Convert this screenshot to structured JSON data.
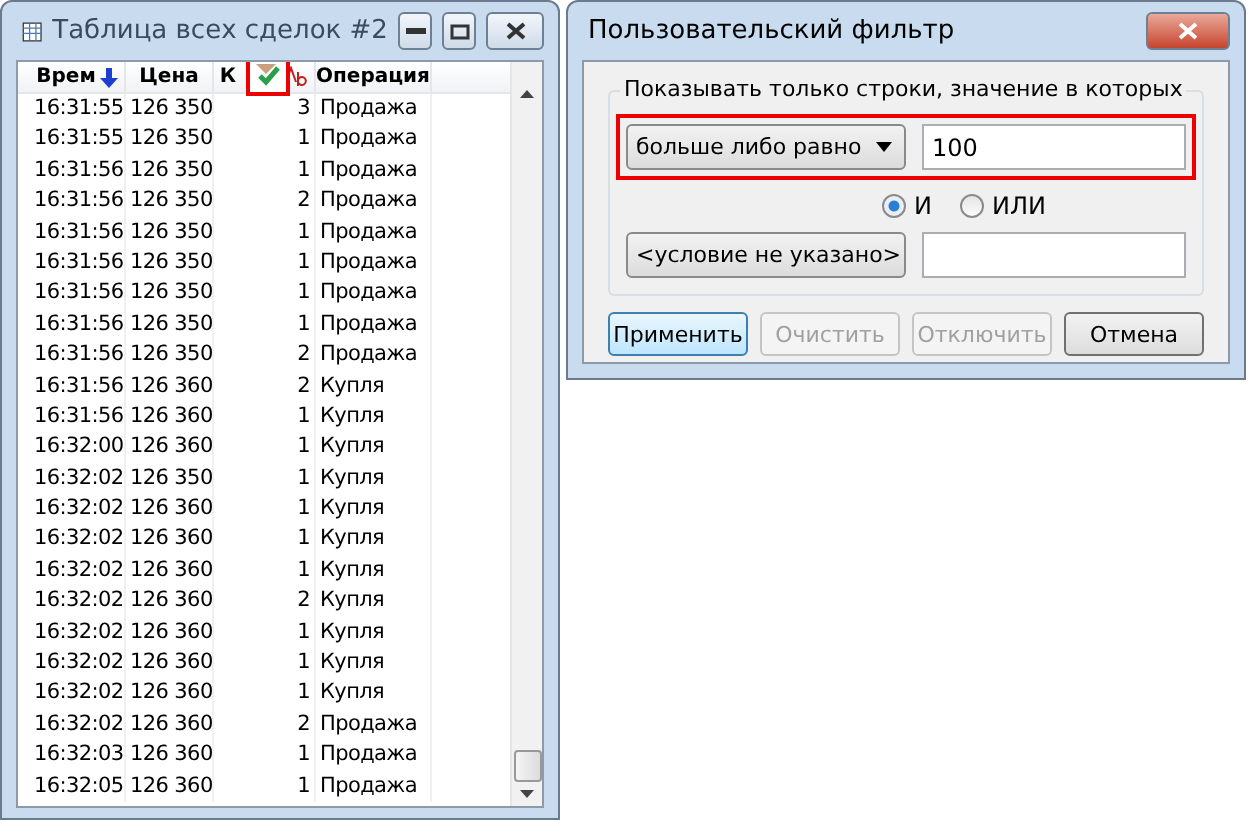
{
  "trades_window": {
    "title": "Таблица всех сделок #2",
    "columns": [
      "Врем",
      "Цена",
      "К",
      "Операция"
    ],
    "rows": [
      [
        "16:31:55",
        "126 350",
        "3",
        "Продажа"
      ],
      [
        "16:31:55",
        "126 350",
        "1",
        "Продажа"
      ],
      [
        "16:31:56",
        "126 350",
        "1",
        "Продажа"
      ],
      [
        "16:31:56",
        "126 350",
        "2",
        "Продажа"
      ],
      [
        "16:31:56",
        "126 350",
        "1",
        "Продажа"
      ],
      [
        "16:31:56",
        "126 350",
        "1",
        "Продажа"
      ],
      [
        "16:31:56",
        "126 350",
        "1",
        "Продажа"
      ],
      [
        "16:31:56",
        "126 350",
        "1",
        "Продажа"
      ],
      [
        "16:31:56",
        "126 350",
        "2",
        "Продажа"
      ],
      [
        "16:31:56",
        "126 360",
        "2",
        "Купля"
      ],
      [
        "16:31:56",
        "126 360",
        "1",
        "Купля"
      ],
      [
        "16:32:00",
        "126 360",
        "1",
        "Купля"
      ],
      [
        "16:32:02",
        "126 350",
        "1",
        "Купля"
      ],
      [
        "16:32:02",
        "126 360",
        "1",
        "Купля"
      ],
      [
        "16:32:02",
        "126 360",
        "1",
        "Купля"
      ],
      [
        "16:32:02",
        "126 360",
        "1",
        "Купля"
      ],
      [
        "16:32:02",
        "126 360",
        "2",
        "Купля"
      ],
      [
        "16:32:02",
        "126 360",
        "1",
        "Купля"
      ],
      [
        "16:32:02",
        "126 360",
        "1",
        "Купля"
      ],
      [
        "16:32:02",
        "126 360",
        "1",
        "Купля"
      ],
      [
        "16:32:02",
        "126 360",
        "2",
        "Продажа"
      ],
      [
        "16:32:03",
        "126 360",
        "1",
        "Продажа"
      ],
      [
        "16:32:05",
        "126 360",
        "1",
        "Продажа"
      ]
    ]
  },
  "filter_dialog": {
    "title": "Пользовательский фильтр",
    "group_label": "Показывать только строки, значение в которых",
    "condition_1": "больше либо равно",
    "value_1": "100",
    "logic": [
      {
        "label": "И",
        "selected": true
      },
      {
        "label": "ИЛИ",
        "selected": false
      }
    ],
    "condition_2": "<условие не указано>",
    "buttons": [
      {
        "label": "Применить",
        "disabled": false,
        "default": true
      },
      {
        "label": "Очистить",
        "disabled": true,
        "default": false
      },
      {
        "label": "Отключить",
        "disabled": true,
        "default": false
      },
      {
        "label": "Отмена",
        "disabled": false,
        "default": false
      }
    ]
  }
}
